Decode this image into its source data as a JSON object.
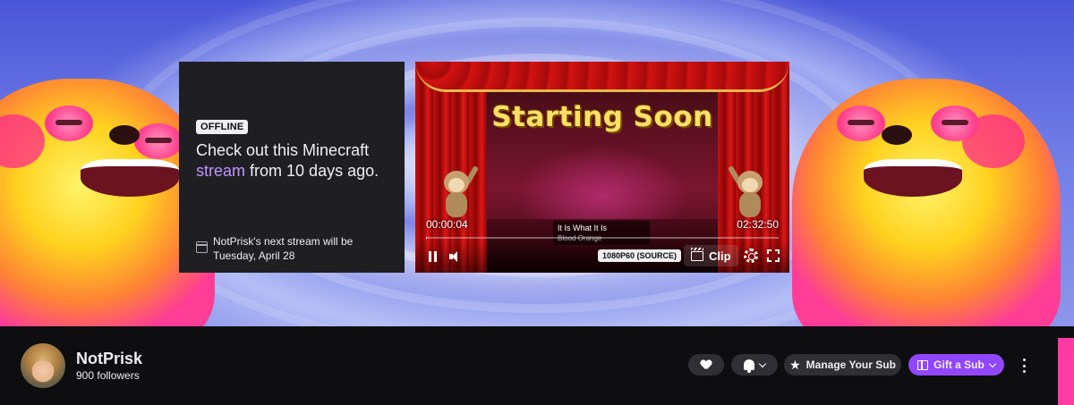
{
  "offline": {
    "badge": "OFFLINE",
    "title_prefix": "Check out this Minecraft",
    "title_link": "stream",
    "title_suffix": "from 10 days ago.",
    "next_stream_line1": "NotPrisk's next stream will be",
    "next_stream_line2": "Tuesday, April 28"
  },
  "player": {
    "overlay_text": "Starting Soon",
    "time_elapsed": "00:00:04",
    "time_total": "02:32:50",
    "progress": 0.0,
    "song_title": "It Is What It Is",
    "song_artist": "Blood Orange",
    "quality": "1080P60 (SOURCE)",
    "clip_label": "Clip"
  },
  "channel": {
    "name": "NotPrisk",
    "followers": "900 followers",
    "manage_sub_label": "Manage Your Sub",
    "gift_sub_label": "Gift a Sub"
  },
  "colors": {
    "accent": "#9147ff",
    "link": "#bf94ff",
    "background": "#0e0e10",
    "card": "#1f1f23"
  }
}
